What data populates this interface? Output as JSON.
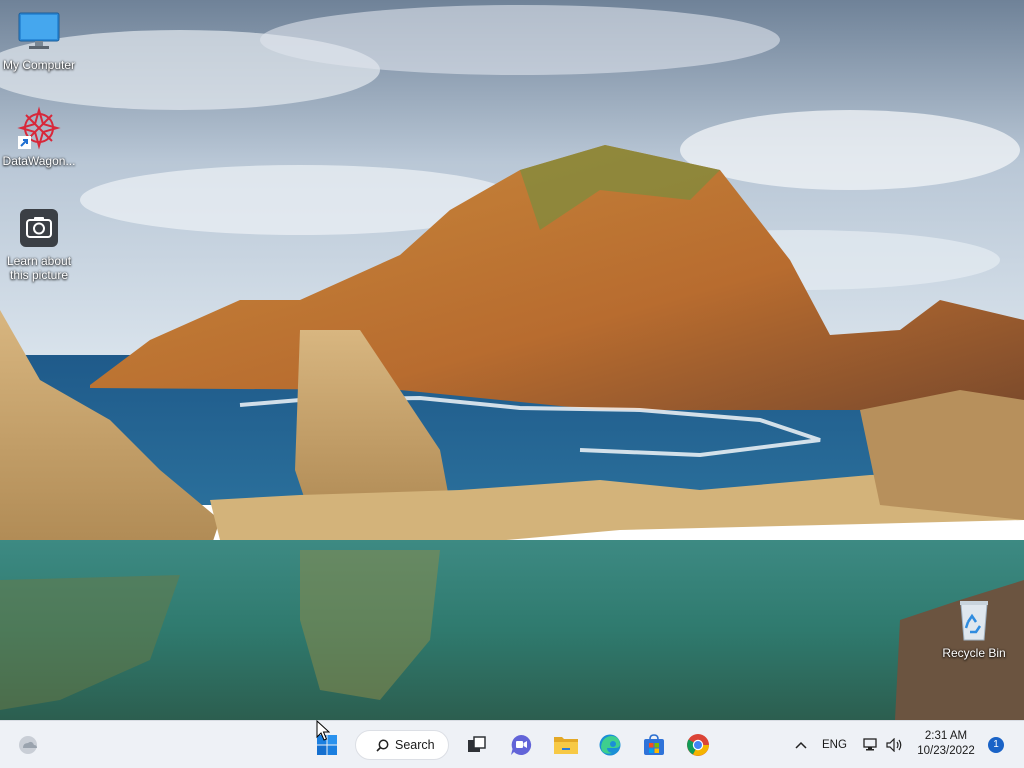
{
  "desktop": {
    "icons": [
      {
        "label": "My Computer",
        "icon": "monitor-icon"
      },
      {
        "label": "DataWagon...",
        "icon": "datawagon-logo-icon"
      },
      {
        "label": "Learn about this picture",
        "icon": "camera-icon"
      },
      {
        "label": "Recycle Bin",
        "icon": "recycle-bin-icon"
      }
    ]
  },
  "taskbar": {
    "widgets_icon": "weather-widget-icon",
    "start_icon": "windows-start-icon",
    "search_label": "Search",
    "apps": [
      {
        "name": "Task View",
        "icon": "task-view-icon"
      },
      {
        "name": "Chat",
        "icon": "teams-chat-icon"
      },
      {
        "name": "File Explorer",
        "icon": "folder-icon"
      },
      {
        "name": "Microsoft Edge",
        "icon": "edge-icon"
      },
      {
        "name": "Microsoft Store",
        "icon": "store-icon"
      },
      {
        "name": "Google Chrome",
        "icon": "chrome-icon"
      }
    ],
    "tray": {
      "language": "ENG",
      "time": "2:31 AM",
      "date": "10/23/2022",
      "notification_count": "1"
    }
  },
  "colors": {
    "taskbar_bg": "#eef1f6",
    "accent": "#1a63c7"
  }
}
